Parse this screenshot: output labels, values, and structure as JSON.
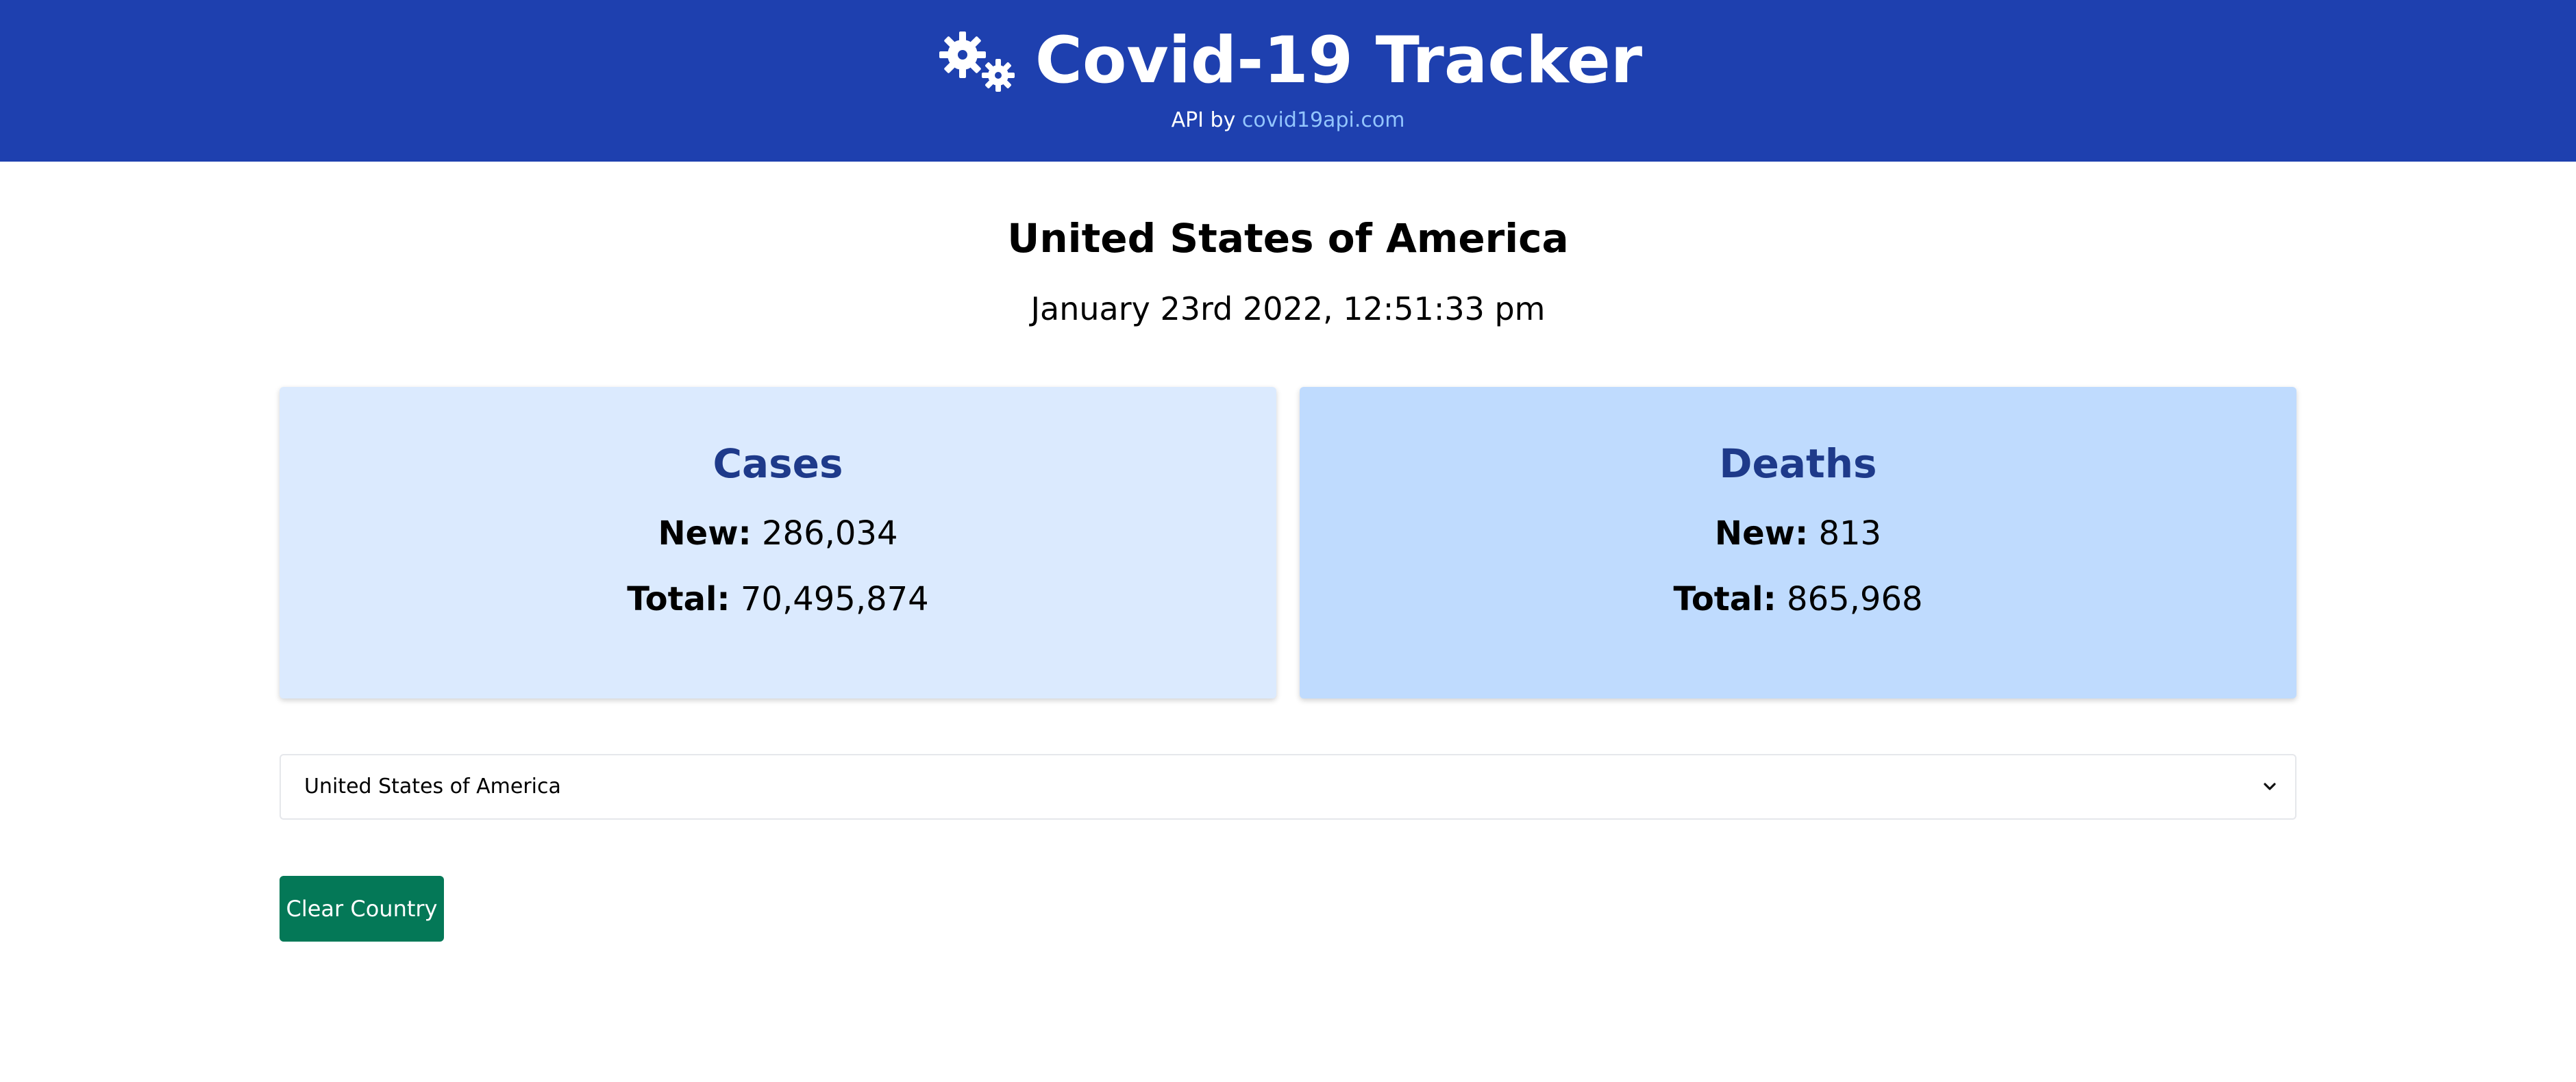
{
  "header": {
    "title": "Covid-19 Tracker",
    "logo_icon": "virus-gears-icon",
    "subtitle_prefix": "API by",
    "subtitle_link": "covid19api.com",
    "background_color": "#1e40af",
    "link_color": "#93c5fd"
  },
  "main": {
    "country": "United States of America",
    "timestamp": "January 23rd 2022, 12:51:33 pm"
  },
  "cards": {
    "cases": {
      "title": "Cases",
      "new_label": "New:",
      "new_value": "286,034",
      "total_label": "Total:",
      "total_value": "70,495,874",
      "background_color": "#dbeafe"
    },
    "deaths": {
      "title": "Deaths",
      "new_label": "New:",
      "new_value": "813",
      "total_label": "Total:",
      "total_value": "865,968",
      "background_color": "#bfdbfe"
    },
    "title_color": "#1e3a8a"
  },
  "country_select": {
    "selected": "United States of America",
    "icon": "chevron-down-icon"
  },
  "clear_button": {
    "label": "Clear Country",
    "color": "#047857"
  }
}
